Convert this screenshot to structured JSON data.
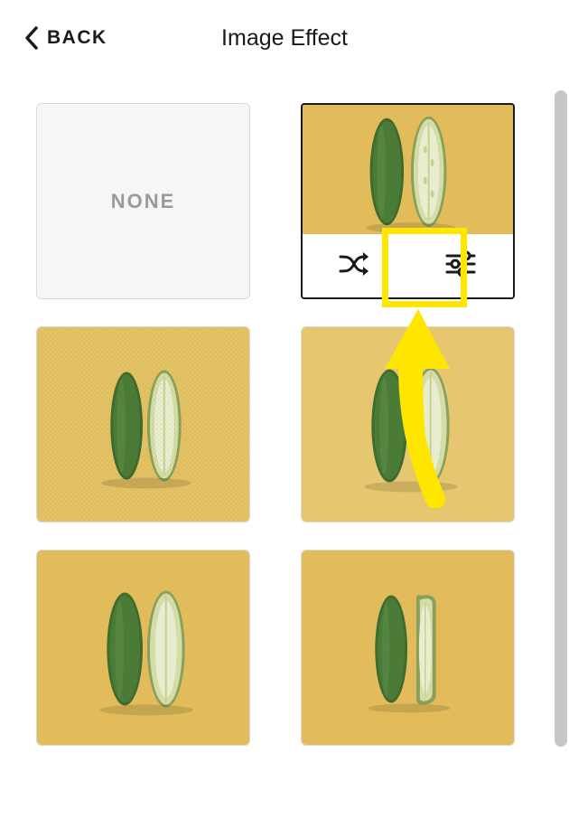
{
  "header": {
    "back_label": "BACK",
    "title": "Image Effect"
  },
  "tiles": {
    "none_label": "NONE"
  },
  "actions": {
    "shuffle": "shuffle",
    "adjust": "adjust"
  }
}
